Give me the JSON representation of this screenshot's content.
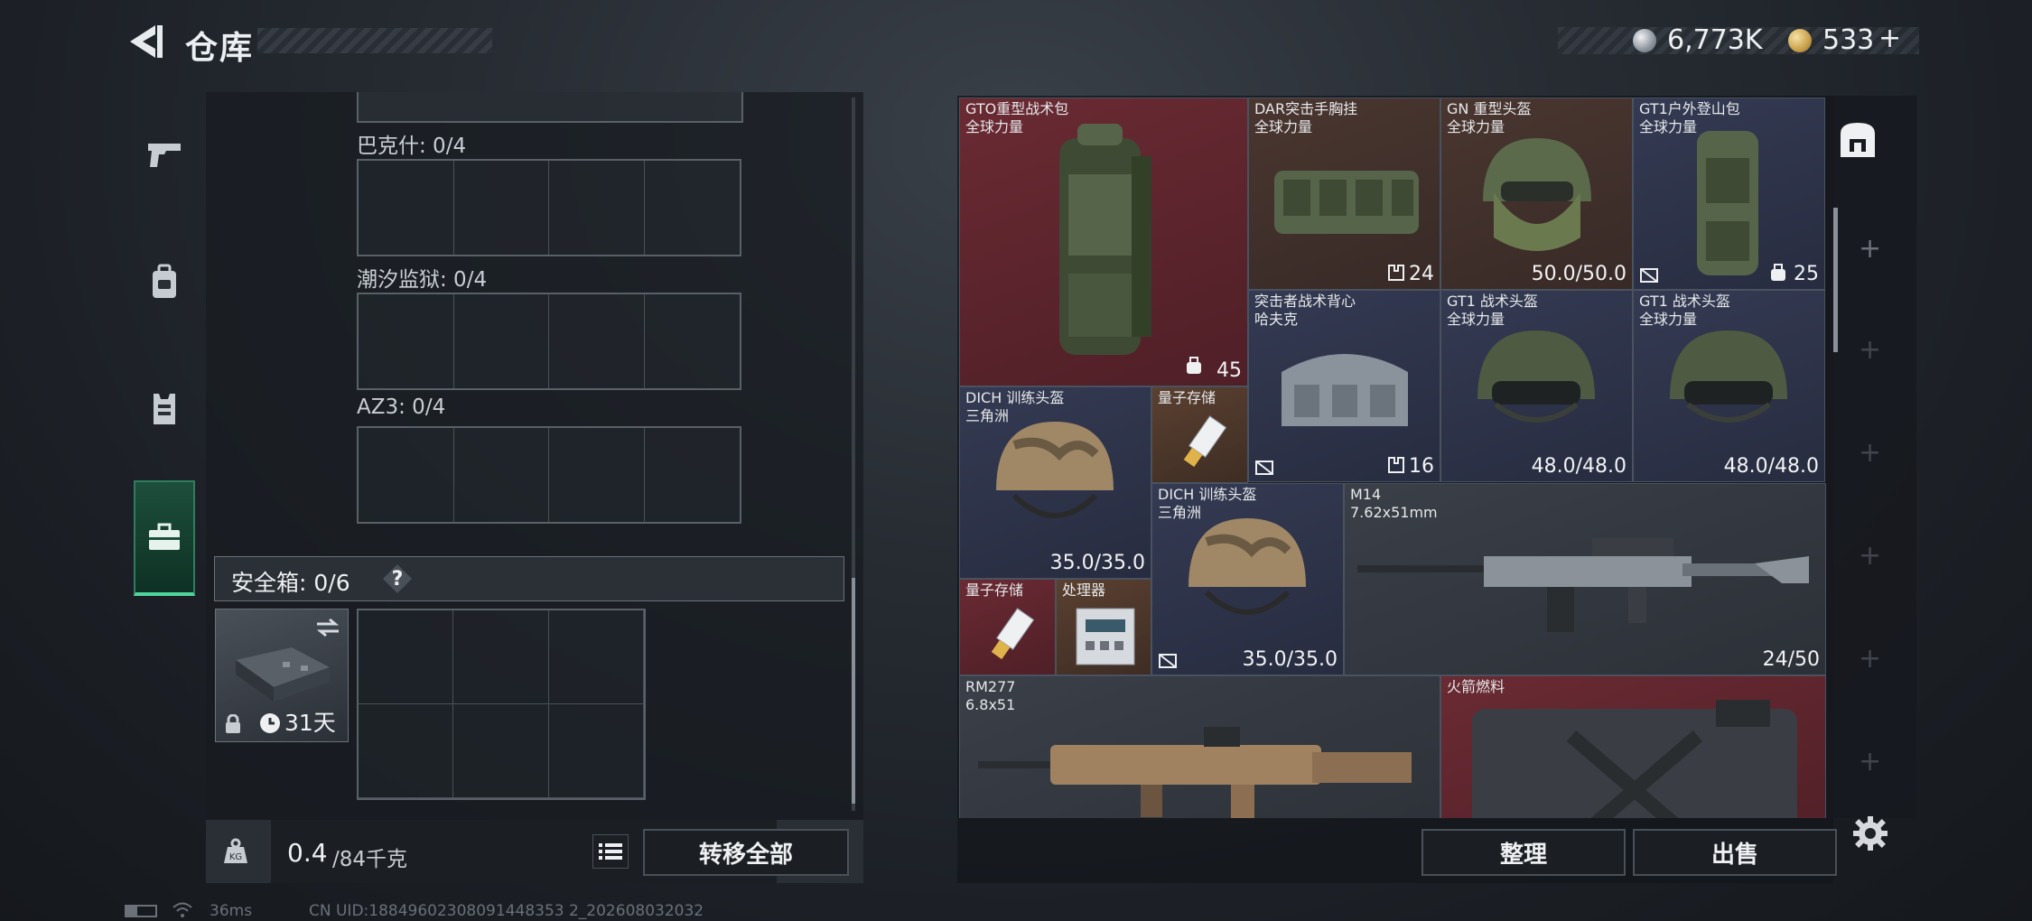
{
  "header": {
    "title": "仓库",
    "currency1": "6,773K",
    "currency2": "533",
    "currency2_add": "+"
  },
  "left_tabs": [
    {
      "name": "weapons",
      "icon": "pistol-icon"
    },
    {
      "name": "gear",
      "icon": "backpack-icon"
    },
    {
      "name": "armor",
      "icon": "vest-icon"
    },
    {
      "name": "case",
      "icon": "briefcase-icon",
      "active": true
    }
  ],
  "containers": [
    {
      "label": "巴克什: 0/4"
    },
    {
      "label": "潮汐监狱: 0/4"
    },
    {
      "label": "AZ3: 0/4"
    }
  ],
  "safe_box": {
    "label": "安全箱: 0/6",
    "help": "?",
    "days": "31天"
  },
  "weight": {
    "current": "0.4",
    "max": "/84千克"
  },
  "buttons": {
    "transfer_all": "转移全部",
    "organize": "整理",
    "sell": "出售"
  },
  "inventory": {
    "gto": {
      "name": "GTO重型战术包",
      "sub": "全球力量",
      "value": "45"
    },
    "dar": {
      "name": "DAR突击手胸挂",
      "sub": "全球力量",
      "value": "24"
    },
    "gn": {
      "name": "GN 重型头盔",
      "sub": "全球力量",
      "value": "50.0/50.0"
    },
    "gt1bag": {
      "name": "GT1户外登山包",
      "sub": "全球力量",
      "value": "25"
    },
    "assault": {
      "name": "突击者战术背心",
      "sub": "哈夫克",
      "value": "16"
    },
    "gt1h1": {
      "name": "GT1 战术头盔",
      "sub": "全球力量",
      "value": "48.0/48.0"
    },
    "gt1h2": {
      "name": "GT1 战术头盔",
      "sub": "全球力量",
      "value": "48.0/48.0"
    },
    "dich1": {
      "name": "DICH 训练头盔",
      "sub": "三角洲",
      "value": "35.0/35.0"
    },
    "quantum1": {
      "name": "量子存储"
    },
    "dich2": {
      "name": "DICH 训练头盔",
      "sub": "三角洲",
      "value": "35.0/35.0"
    },
    "m14": {
      "name": "M14",
      "sub": "7.62x51mm",
      "value": "24/50"
    },
    "quantum2": {
      "name": "量子存储"
    },
    "processor": {
      "name": "处理器"
    },
    "rm277": {
      "name": "RM277",
      "sub": "6.8x51"
    },
    "rocket": {
      "name": "火箭燃料"
    }
  },
  "status": {
    "ping": "36ms",
    "uid": "CN UID:18849602308091448353 2_202608032032"
  },
  "colors": {
    "accent_green": "#4fd49b",
    "cell_red": "#5a2530",
    "cell_navy": "#2d3347"
  }
}
